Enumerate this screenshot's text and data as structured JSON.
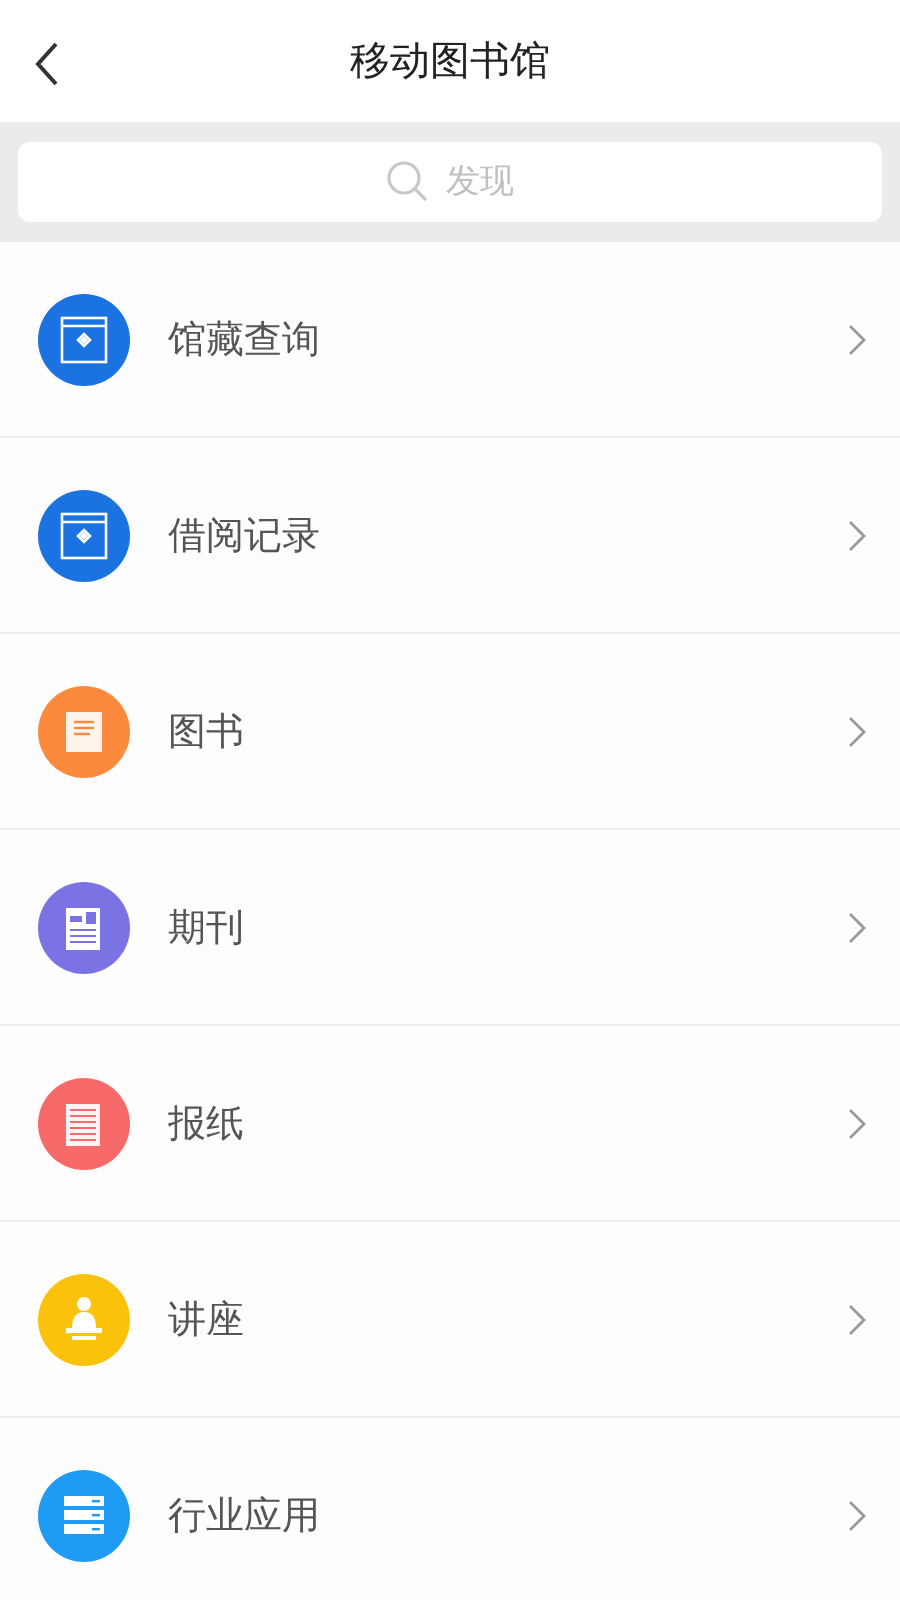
{
  "header": {
    "title": "移动图书馆"
  },
  "search": {
    "placeholder": "发现"
  },
  "menu": [
    {
      "label": "馆藏查询",
      "kind": "catalog",
      "color": "#1a73e0"
    },
    {
      "label": "借阅记录",
      "kind": "catalog",
      "color": "#1a73e0"
    },
    {
      "label": "图书",
      "kind": "book",
      "color": "#fb8a3c"
    },
    {
      "label": "期刊",
      "kind": "magazine",
      "color": "#7b73e3"
    },
    {
      "label": "报纸",
      "kind": "newspaper",
      "color": "#f86a6a"
    },
    {
      "label": "讲座",
      "kind": "lecture",
      "color": "#fbc20c"
    },
    {
      "label": "行业应用",
      "kind": "server",
      "color": "#1e9cf5"
    }
  ]
}
